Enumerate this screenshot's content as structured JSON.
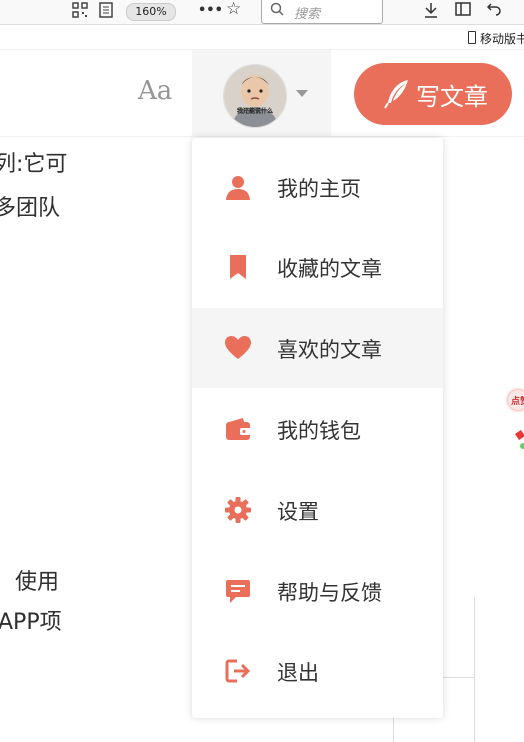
{
  "browser": {
    "zoom": "160%",
    "search_placeholder": "搜索",
    "mobile_bookmark": "移动版书"
  },
  "navbar": {
    "font_button": "Aa",
    "write_button": "写文章",
    "avatar_caption": "我还能说什么"
  },
  "background_text": {
    "line1": "列:它可",
    "line2": "多团队",
    "line3": "使用",
    "line4": "APP项",
    "side_hint": "点赞"
  },
  "dropdown": {
    "items": [
      {
        "label": "我的主页",
        "icon": "user-icon"
      },
      {
        "label": "收藏的文章",
        "icon": "bookmark-icon"
      },
      {
        "label": "喜欢的文章",
        "icon": "heart-icon"
      },
      {
        "label": "我的钱包",
        "icon": "wallet-icon"
      },
      {
        "label": "设置",
        "icon": "gear-icon"
      },
      {
        "label": "帮助与反馈",
        "icon": "feedback-icon"
      },
      {
        "label": "退出",
        "icon": "logout-icon"
      }
    ],
    "active_index": 2
  },
  "colors": {
    "accent": "#ea6f5a",
    "hover_bg": "#f5f5f5"
  }
}
